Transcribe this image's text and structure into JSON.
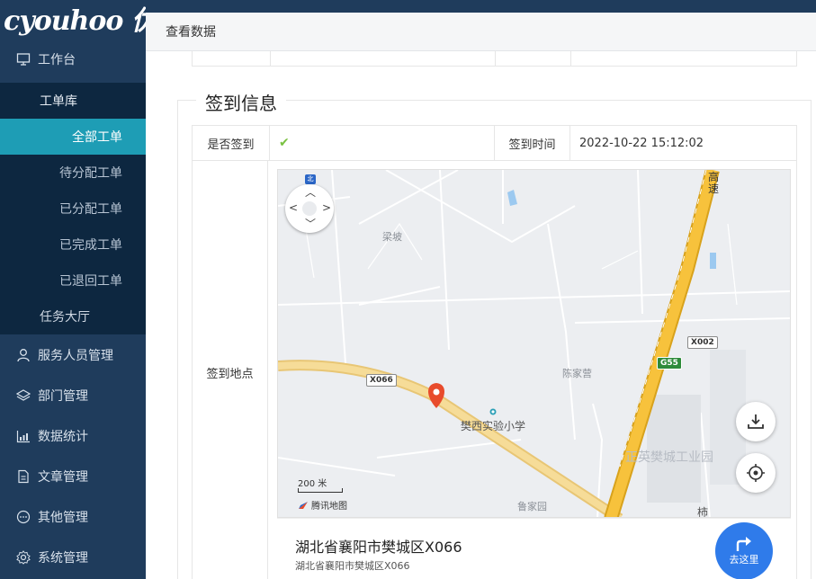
{
  "sidebar": {
    "logo": "cyouhoo 优",
    "workbench": "工作台",
    "workorder_lib": "工单库",
    "items": [
      "全部工单",
      "待分配工单",
      "已分配工单",
      "已完成工单",
      "已退回工单"
    ],
    "task_hall": "任务大厅",
    "lower": [
      "服务人员管理",
      "部门管理",
      "数据统计",
      "文章管理",
      "其他管理",
      "系统管理"
    ]
  },
  "dialog": {
    "title": "查看数据"
  },
  "checkin": {
    "legend": "签到信息",
    "checked_label": "是否签到",
    "checked_value": "✔",
    "time_label": "签到时间",
    "time_value": "2022-10-22 15:12:02",
    "location_label": "签到地点"
  },
  "map": {
    "labels": {
      "liangpo": "梁坡",
      "chenjiaying": "陈家营",
      "school": "樊西实验小学",
      "industrial_park": "正英樊城工业园",
      "lujiayuan": "鲁家园",
      "shi": "柿",
      "gaosu": "高速"
    },
    "roads": {
      "x066": "X066",
      "x002": "X002",
      "g55": "G55"
    },
    "scale": "200 米",
    "provider": "腾讯地图",
    "compass": "北",
    "address_title": "湖北省襄阳市樊城区X066",
    "address_sub": "湖北省襄阳市樊城区X066",
    "go_label": "去这里"
  },
  "colors": {
    "sidebar_bg": "#1f3c5c",
    "active": "#1e9db5",
    "go_button": "#2f7bea",
    "highway": "#f7c23c"
  }
}
